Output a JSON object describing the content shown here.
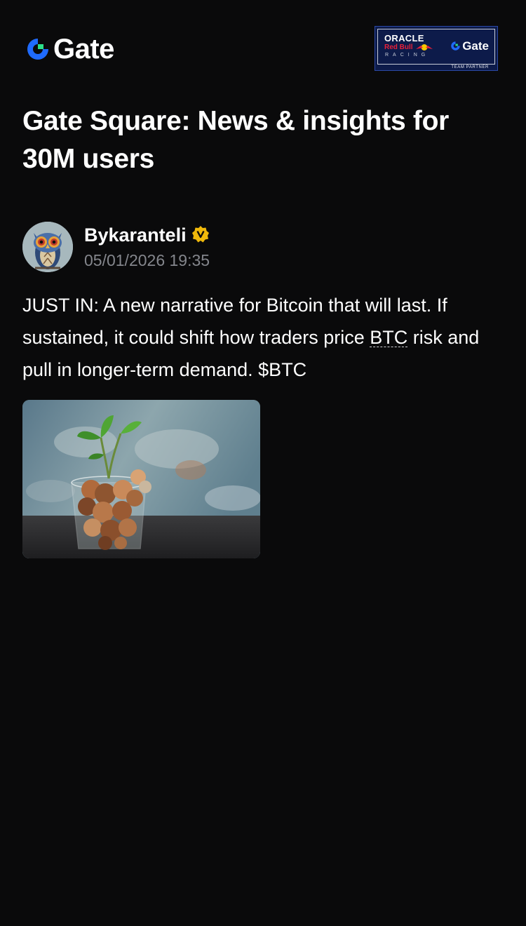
{
  "header": {
    "logo_text": "Gate",
    "partner": {
      "oracle": "ORACLE",
      "red_bull": "Red Bull",
      "racing": "RACING",
      "gate": "Gate",
      "team_partner": "TEAM PARTNER"
    }
  },
  "page": {
    "title": "Gate Square: News & insights for 30M users"
  },
  "post": {
    "author": "Bykaranteli",
    "timestamp": "05/01/2026 19:35",
    "verified_badge": "V",
    "body_before": "JUST IN: A new narrative for Bitcoin that will last. If sustained, it could shift how traders price ",
    "ticker": "BTC",
    "body_after": " risk and pull in longer-term demand. $BTC"
  },
  "colors": {
    "background": "#0a0a0b",
    "brand_blue": "#1f6bff",
    "brand_green": "#2ce08a",
    "muted_text": "#84868c",
    "verified_gold": "#f0b90b"
  },
  "icons": {
    "logo": "gate-logo-icon",
    "verified": "verified-badge-icon",
    "avatar": "owl-avatar",
    "image": "coin-jar-plant-image"
  }
}
